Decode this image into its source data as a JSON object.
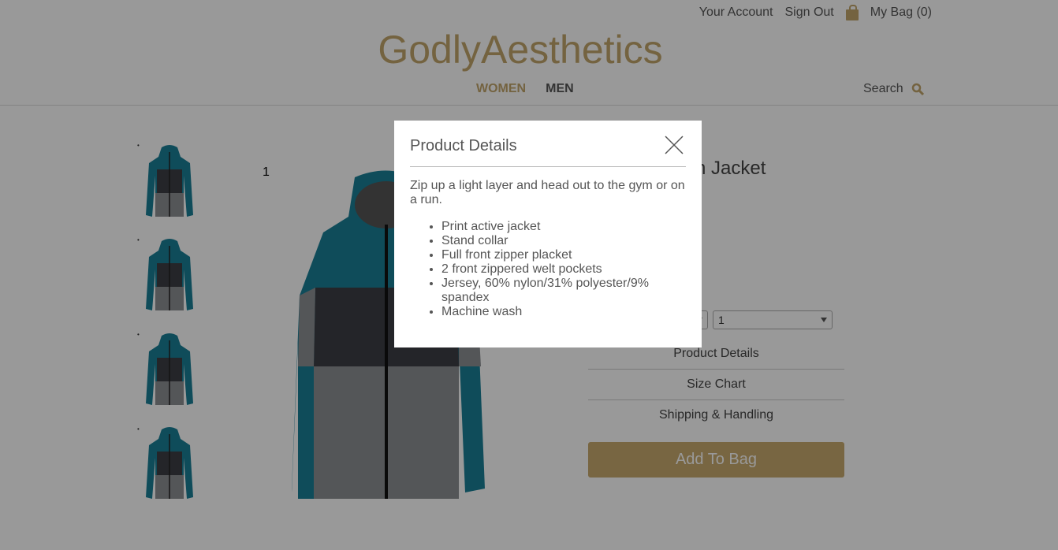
{
  "header": {
    "account_label": "Your Account",
    "signout_label": "Sign Out",
    "bag_label": "My Bag (0)",
    "logo": "GodlyAesthetics",
    "nav": {
      "women": "WOMEN",
      "men": "MEN"
    },
    "search_label": "Search"
  },
  "gallery": {
    "slide_number": "1"
  },
  "product": {
    "title_visible": "n Jacket",
    "quantity_value": "1",
    "accordion": [
      "Product Details",
      "Size Chart",
      "Shipping & Handling"
    ],
    "add_to_bag": "Add To Bag"
  },
  "modal": {
    "title": "Product Details",
    "description": "Zip up a light layer and head out to the gym or on a run.",
    "features": [
      "Print active jacket",
      "Stand collar",
      "Full front zipper placket",
      "2 front zippered welt pockets",
      "Jersey, 60% nylon/31% polyester/9% spandex",
      "Machine wash"
    ]
  },
  "colors": {
    "accent": "#c2a56b",
    "jacket_teal": "#1a7f97",
    "jacket_dark": "#3c3f45",
    "jacket_gray": "#8d8f93"
  }
}
